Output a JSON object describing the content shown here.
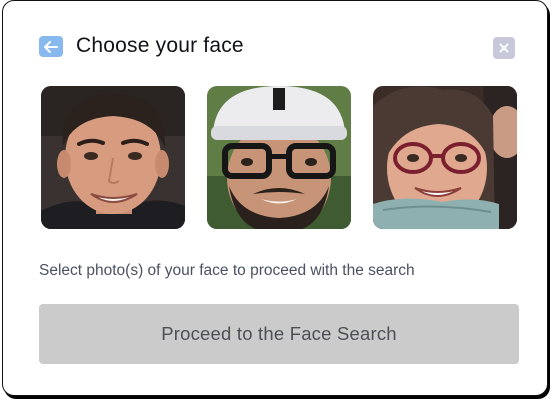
{
  "dialog": {
    "title": "Choose your face",
    "helper_text": "Select photo(s) of your face to proceed with the search",
    "proceed_button_label": "Proceed to the Face Search",
    "back_icon": "arrow-left-icon",
    "close_icon": "close-icon"
  },
  "photos": [
    {
      "label": "face-photo-1"
    },
    {
      "label": "face-photo-2"
    },
    {
      "label": "face-photo-3"
    }
  ],
  "colors": {
    "back_button": "#87b9ef",
    "close_button": "#c7c9da",
    "proceed_button_bg": "#cbcbcb",
    "proceed_button_text": "#4d4f55"
  }
}
